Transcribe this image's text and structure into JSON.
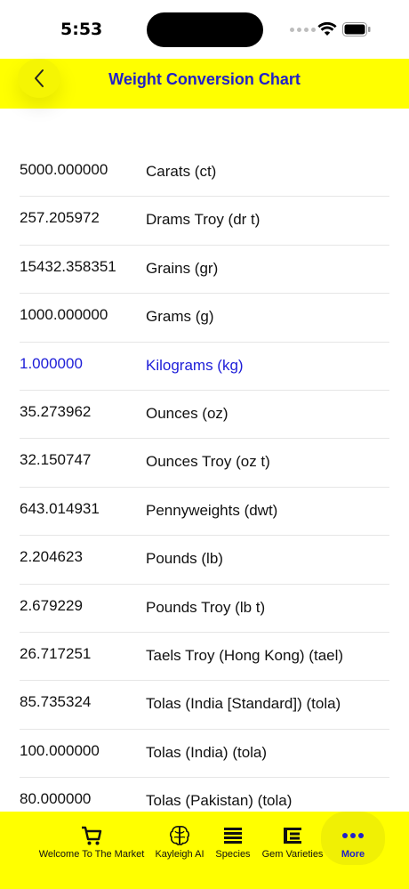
{
  "status_bar": {
    "time": "5:53"
  },
  "header": {
    "title": "Weight Conversion Chart",
    "back_icon": "chevron-left-icon"
  },
  "conversions": [
    {
      "value": "5000.000000",
      "unit": "Carats (ct)"
    },
    {
      "value": "257.205972",
      "unit": "Drams Troy (dr t)"
    },
    {
      "value": "15432.358351",
      "unit": "Grains (gr)"
    },
    {
      "value": "1000.000000",
      "unit": "Grams (g)"
    },
    {
      "value": "1.000000",
      "unit": "Kilograms (kg)",
      "selected": true
    },
    {
      "value": "35.273962",
      "unit": "Ounces (oz)"
    },
    {
      "value": "32.150747",
      "unit": "Ounces Troy (oz t)"
    },
    {
      "value": "643.014931",
      "unit": "Pennyweights (dwt)"
    },
    {
      "value": "2.204623",
      "unit": "Pounds (lb)"
    },
    {
      "value": "2.679229",
      "unit": "Pounds Troy (lb t)"
    },
    {
      "value": "26.717251",
      "unit": "Taels Troy (Hong Kong) (tael)"
    },
    {
      "value": "85.735324",
      "unit": "Tolas (India [Standard]) (tola)"
    },
    {
      "value": "100.000000",
      "unit": "Tolas (India) (tola)"
    },
    {
      "value": "80.000000",
      "unit": "Tolas (Pakistan) (tola)"
    }
  ],
  "tab_bar": {
    "tabs": [
      {
        "label": "Welcome To The Market",
        "icon": "cart-icon"
      },
      {
        "label": "Kayleigh AI",
        "icon": "brain-icon"
      },
      {
        "label": "Species",
        "icon": "list-icon"
      },
      {
        "label": "Gem Varieties",
        "icon": "varieties-icon"
      },
      {
        "label": "More",
        "icon": "more-dots-icon",
        "active": true
      }
    ]
  },
  "colors": {
    "accent_yellow": "#ffff00",
    "title_blue": "#2121c8",
    "selected_blue": "#1d1dd8"
  }
}
